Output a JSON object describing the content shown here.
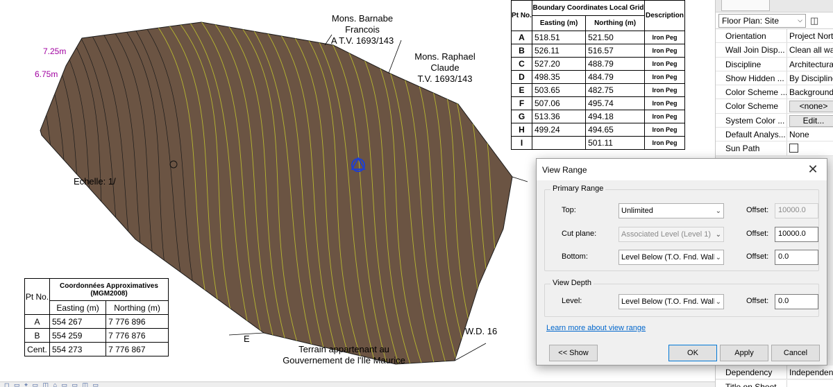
{
  "map": {
    "owner_top": [
      "Mons. Barnabe",
      "Francois",
      "A T.V. 1693/143"
    ],
    "owner_right": [
      "Mons. Raphael",
      "Claude",
      "T.V. 1693/143"
    ],
    "owner_bottom": [
      "Terrain appartenant au",
      "Gouvernement de l'Ile Maurice"
    ],
    "scale_label": "Echelle: 1/",
    "wd_label": "W.D. 16",
    "e_label": "E",
    "contour_left_1": "7.25m",
    "contour_left_2": "6.75m"
  },
  "table_bottom": {
    "pt_header": "Pt No.",
    "title": "Coordonnées Approximatives (MGM2008)",
    "col_e": "Easting (m)",
    "col_n": "Northing (m)",
    "rows": [
      {
        "pt": "A",
        "e": "554 267",
        "n": "7 776 896"
      },
      {
        "pt": "B",
        "e": "554 259",
        "n": "7 776 876"
      },
      {
        "pt": "Cent.",
        "e": "554 273",
        "n": "7 776 867"
      }
    ]
  },
  "table_top": {
    "pt_header": "Pt No.",
    "title": "Boundary Coordinates Local Grid",
    "col_e": "Easting (m)",
    "col_n": "Northing (m)",
    "col_d": "Description",
    "rows": [
      {
        "pt": "A",
        "e": "518.51",
        "n": "521.50",
        "d": "Iron Peg"
      },
      {
        "pt": "B",
        "e": "526.11",
        "n": "516.57",
        "d": "Iron Peg"
      },
      {
        "pt": "C",
        "e": "527.20",
        "n": "488.79",
        "d": "Iron Peg"
      },
      {
        "pt": "D",
        "e": "498.35",
        "n": "484.79",
        "d": "Iron Peg"
      },
      {
        "pt": "E",
        "e": "503.65",
        "n": "482.75",
        "d": "Iron Peg"
      },
      {
        "pt": "F",
        "e": "507.06",
        "n": "495.74",
        "d": "Iron Peg"
      },
      {
        "pt": "G",
        "e": "513.36",
        "n": "494.18",
        "d": "Iron Peg"
      },
      {
        "pt": "H",
        "e": "499.24",
        "n": "494.65",
        "d": "Iron Peg"
      },
      {
        "pt": "I",
        "e": "",
        "n": "501.11",
        "d": "Iron Peg"
      }
    ]
  },
  "properties": {
    "type_selector": "Floor Plan: Site",
    "rows": [
      {
        "label": "Orientation",
        "value": "Project North"
      },
      {
        "label": "Wall Join Disp...",
        "value": "Clean all wall joins"
      },
      {
        "label": "Discipline",
        "value": "Architectural"
      },
      {
        "label": "Show Hidden ...",
        "value": "By Discipline"
      },
      {
        "label": "Color Scheme ...",
        "value": "Background"
      },
      {
        "label": "Color Scheme",
        "value": "<none>",
        "button": true
      },
      {
        "label": "System Color ...",
        "value": "Edit...",
        "button": true
      },
      {
        "label": "Default Analys...",
        "value": "None"
      },
      {
        "label": "Sun Path",
        "value": "",
        "checkbox": true
      }
    ],
    "bottom_rows": [
      {
        "label": "Dependency",
        "value": "Independent"
      },
      {
        "label": "Title on Sheet",
        "value": ""
      }
    ]
  },
  "dialog": {
    "title": "View Range",
    "primary_range": "Primary Range",
    "top_label": "Top:",
    "top_value": "Unlimited",
    "top_offset": "10000.0",
    "cut_label": "Cut plane:",
    "cut_value": "Associated Level (Level 1)",
    "cut_offset": "10000.0",
    "bottom_label": "Bottom:",
    "bottom_value": "Level Below (T.O. Fnd. Wall)",
    "bottom_offset": "0.0",
    "view_depth": "View Depth",
    "level_label": "Level:",
    "level_value": "Level Below (T.O. Fnd. Wall)",
    "level_offset": "0.0",
    "offset_label": "Offset:",
    "learn_more": "Learn more about view range",
    "show_btn": "<< Show",
    "ok_btn": "OK",
    "apply_btn": "Apply",
    "cancel_btn": "Cancel"
  },
  "colors": {
    "terrain": "#6b5443",
    "contour_major": "#b8b830",
    "contour_minor": "#1a1a1a",
    "marker": "#1f3fd0",
    "accent_link": "#0066cc"
  }
}
